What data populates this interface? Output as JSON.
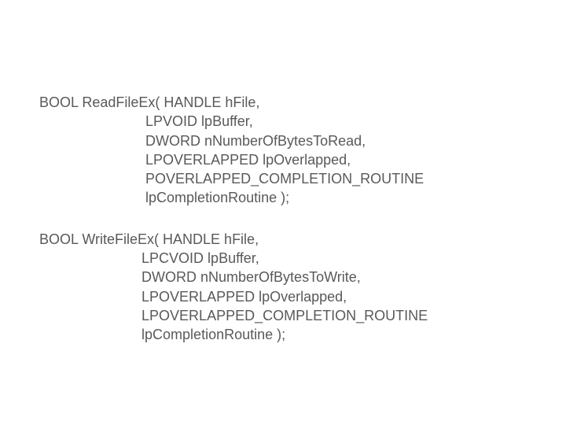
{
  "functions": [
    {
      "name": "ReadFileEx",
      "return_type": "BOOL",
      "prefix": "BOOL ReadFileEx( ",
      "indent": "                           ",
      "first_param": "HANDLE hFile,",
      "params": [
        "LPVOID lpBuffer,",
        "DWORD nNumberOfBytesToRead,",
        "LPOVERLAPPED lpOverlapped,",
        "POVERLAPPED_COMPLETION_ROUTINE",
        "lpCompletionRoutine );"
      ]
    },
    {
      "name": "WriteFileEx",
      "return_type": "BOOL",
      "prefix": "BOOL WriteFileEx( ",
      "indent": "                          ",
      "first_param": "HANDLE hFile,",
      "params": [
        "LPCVOID lpBuffer,",
        "DWORD nNumberOfBytesToWrite,",
        "LPOVERLAPPED lpOverlapped,",
        "LPOVERLAPPED_COMPLETION_ROUTINE",
        "lpCompletionRoutine );"
      ]
    }
  ]
}
